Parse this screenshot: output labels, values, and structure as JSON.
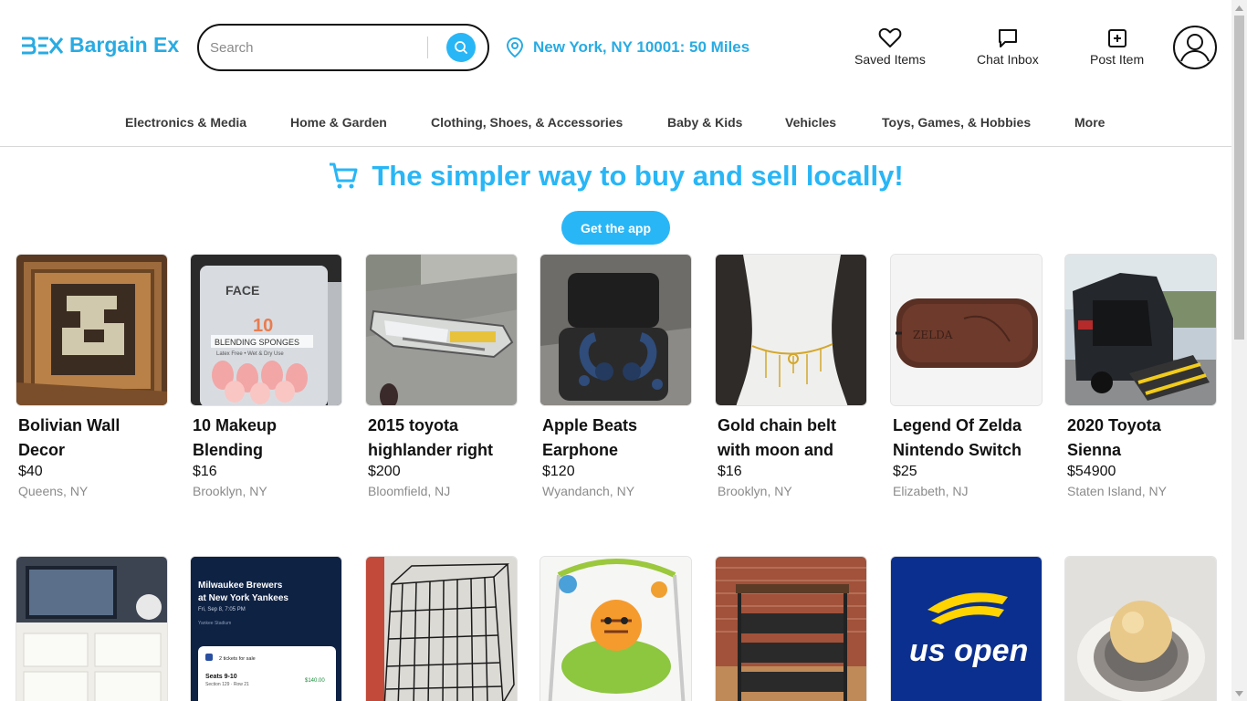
{
  "brand": {
    "logo_mark": "BEX",
    "name": "Bargain Ex"
  },
  "search": {
    "placeholder": "Search"
  },
  "location": {
    "label": "New York, NY 10001: 50 Miles"
  },
  "header_actions": {
    "saved": "Saved Items",
    "chat": "Chat Inbox",
    "post": "Post Item"
  },
  "categories": [
    "Electronics & Media",
    "Home & Garden",
    "Clothing, Shoes, & Accessories",
    "Baby & Kids",
    "Vehicles",
    "Toys, Games, & Hobbies",
    "More"
  ],
  "promo": {
    "title": "The simpler way to buy and sell locally!",
    "button": "Get the app"
  },
  "listings": [
    {
      "title": "Bolivian Wall Decor",
      "price": "$40",
      "location": "Queens, NY"
    },
    {
      "title": "10 Makeup Blending",
      "price": "$16",
      "location": "Brooklyn, NY"
    },
    {
      "title": "2015 toyota highlander right",
      "price": "$200",
      "location": "Bloomfield, NJ"
    },
    {
      "title": "Apple Beats Earphone",
      "price": "$120",
      "location": "Wyandanch, NY"
    },
    {
      "title": "Gold chain belt with moon and",
      "price": "$16",
      "location": "Brooklyn, NY"
    },
    {
      "title": "Legend Of Zelda Nintendo Switch",
      "price": "$25",
      "location": "Elizabeth, NJ"
    },
    {
      "title": "2020 Toyota Sienna",
      "price": "$54900",
      "location": "Staten Island, NY"
    }
  ],
  "image_text": {
    "makeup_brand": "FACE",
    "makeup_label": "BLENDING SPONGES",
    "makeup_num": "10",
    "makeup_sub": "Latex Free • Wet & Dry Use",
    "ticket_title": "Milwaukee Brewers at New York Yankees",
    "ticket_date": "Fri, Sep 8, 7:05 PM",
    "ticket_venue": "Yankee Stadium",
    "ticket_count": "2 tickets for sale",
    "ticket_seats": "Seats 9-10",
    "ticket_section": "Section 129 · Row 21",
    "ticket_price": "$140.00",
    "usopen": "us open",
    "zelda": "ZELDA"
  },
  "colors": {
    "accent": "#29b6f6",
    "brand": "#29abe2",
    "ticket_bg": "#0e2244",
    "usopen_bg": "#0a2f8f",
    "usopen_yellow": "#ffd400"
  }
}
